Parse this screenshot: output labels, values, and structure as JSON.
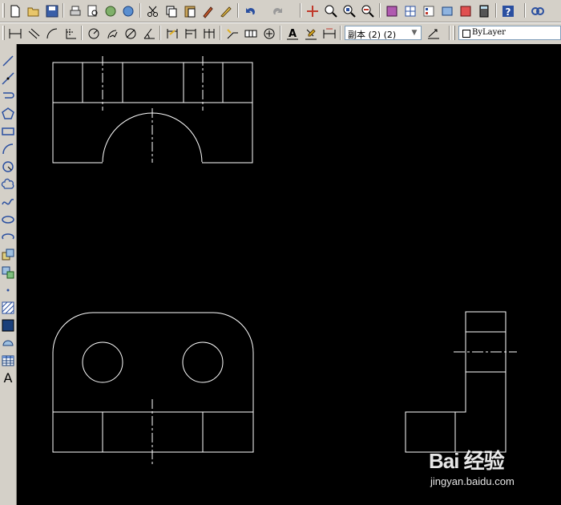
{
  "toolbar_standard": {
    "buttons": [
      "new-icon",
      "open-icon",
      "save-icon",
      "print-icon",
      "plot-preview-icon",
      "publish-icon",
      "3d-dwf-icon",
      "cut-icon",
      "copy-icon",
      "paste-icon",
      "match-properties-icon",
      "block-editor-icon",
      "undo-icon",
      "redo-icon",
      "pan-icon",
      "zoom-realtime-icon",
      "zoom-window-icon",
      "zoom-previous-icon",
      "properties-icon",
      "design-center-icon",
      "tool-palettes-icon",
      "sheet-set-icon",
      "markup-icon",
      "calculator-icon",
      "help-icon"
    ]
  },
  "toolbar_dimension": {
    "buttons": [
      "linear-dim-icon",
      "aligned-dim-icon",
      "arc-length-icon",
      "ordinate-icon",
      "radius-icon",
      "jogged-icon",
      "diameter-icon",
      "angular-icon",
      "quick-dim-icon",
      "baseline-icon",
      "continue-icon",
      "quick-leader-icon",
      "tolerance-icon",
      "center-mark-icon",
      "dimedit-icon",
      "dimtedit-icon",
      "dim-update-icon"
    ],
    "dim_style_value": "副本 (2) (2)",
    "layer_value": "ByLayer"
  },
  "draw_toolbar": {
    "buttons": [
      "line-icon",
      "construction-line-icon",
      "polyline-icon",
      "polygon-icon",
      "rectangle-icon",
      "arc-icon",
      "circle-icon",
      "revision-cloud-icon",
      "spline-icon",
      "ellipse-icon",
      "ellipse-arc-icon",
      "insert-block-icon",
      "make-block-icon",
      "point-icon",
      "hatch-icon",
      "gradient-icon",
      "region-icon",
      "table-icon"
    ],
    "text_label": "A"
  },
  "watermark": {
    "logo": "Bai 经验",
    "url": "jingyan.baidu.com"
  }
}
